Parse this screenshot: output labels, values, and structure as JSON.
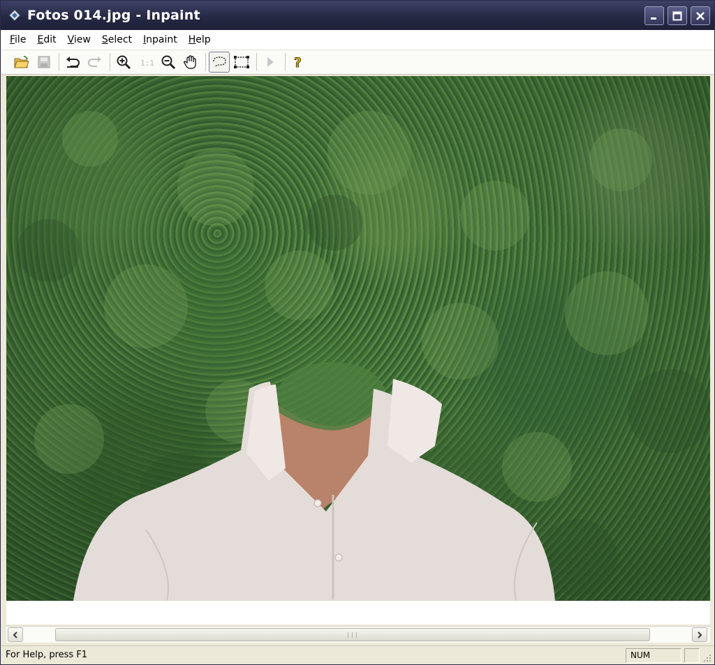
{
  "window": {
    "title": "Fotos 014.jpg - Inpaint"
  },
  "menu": [
    {
      "label_pre": "",
      "label_u": "F",
      "label_post": "ile"
    },
    {
      "label_pre": "",
      "label_u": "E",
      "label_post": "dit"
    },
    {
      "label_pre": "",
      "label_u": "V",
      "label_post": "iew"
    },
    {
      "label_pre": "",
      "label_u": "S",
      "label_post": "elect"
    },
    {
      "label_pre": "",
      "label_u": "I",
      "label_post": "npaint"
    },
    {
      "label_pre": "",
      "label_u": "H",
      "label_post": "elp"
    }
  ],
  "toolbar": {
    "icons": [
      "open-folder-icon",
      "save-icon",
      "undo-icon",
      "redo-icon",
      "zoom-in-icon",
      "actual-size-icon",
      "zoom-out-icon",
      "hand-icon",
      "lasso-icon",
      "rectangle-select-icon",
      "play-icon",
      "help-icon"
    ]
  },
  "scrollbar": {
    "grip": "|||"
  },
  "status": {
    "help": "For Help, press F1",
    "num": "NUM"
  }
}
